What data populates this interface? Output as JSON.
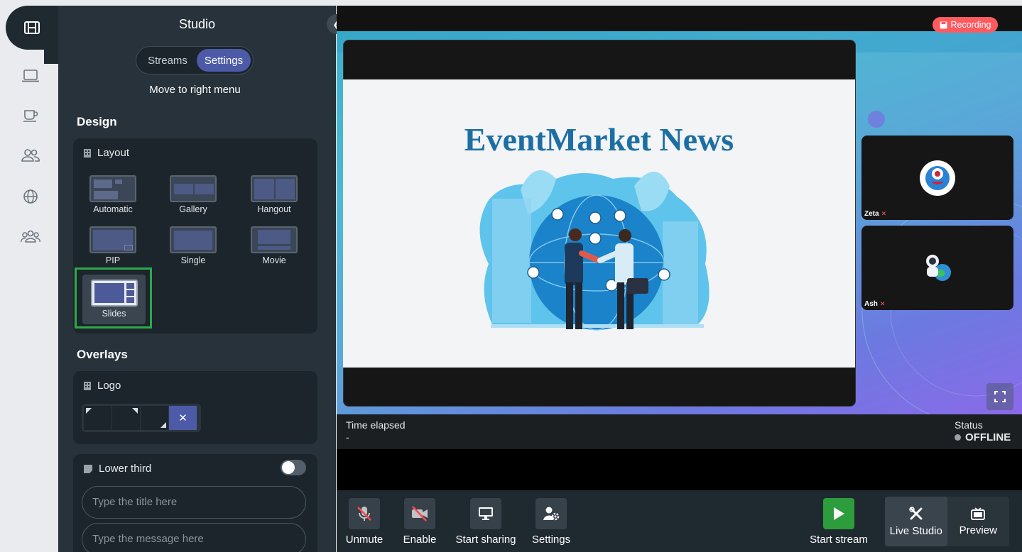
{
  "panel": {
    "title": "Studio",
    "tab_streams": "Streams",
    "tab_settings": "Settings",
    "move_label": "Move to right menu",
    "design_heading": "Design",
    "layout_label": "Layout",
    "layouts": [
      "Automatic",
      "Gallery",
      "Hangout",
      "PIP",
      "Single",
      "Movie",
      "Slides"
    ],
    "overlays_heading": "Overlays",
    "logo_label": "Logo",
    "lower_third_label": "Lower third",
    "title_placeholder": "Type the title here",
    "message_placeholder": "Type the message here"
  },
  "stage": {
    "recording_label": "Recording",
    "slide_title": "EventMarket News",
    "participants": [
      {
        "name": "Zeta"
      },
      {
        "name": "Ash"
      }
    ]
  },
  "info": {
    "time_label": "Time elapsed",
    "time_value": "-",
    "status_label": "Status",
    "status_value": "OFFLINE"
  },
  "controls": {
    "unmute": "Unmute",
    "enable": "Enable",
    "start_sharing": "Start sharing",
    "settings": "Settings",
    "start_stream": "Start stream",
    "live_studio": "Live Studio",
    "preview": "Preview"
  },
  "colors": {
    "accent": "#4c5aa8",
    "recording": "#ff5a60",
    "start_stream": "#2d9c3c",
    "selected_border": "#2fa84a"
  },
  "icons": [
    "film-icon",
    "laptop-icon",
    "coffee-icon",
    "users-icon",
    "globe-icon",
    "group-icon",
    "chevron-left-icon",
    "mic-off-icon",
    "camera-off-icon",
    "monitor-icon",
    "user-gear-icon",
    "play-icon",
    "tools-icon",
    "tv-icon",
    "fullscreen-icon",
    "save-icon",
    "building-icon",
    "note-icon"
  ]
}
